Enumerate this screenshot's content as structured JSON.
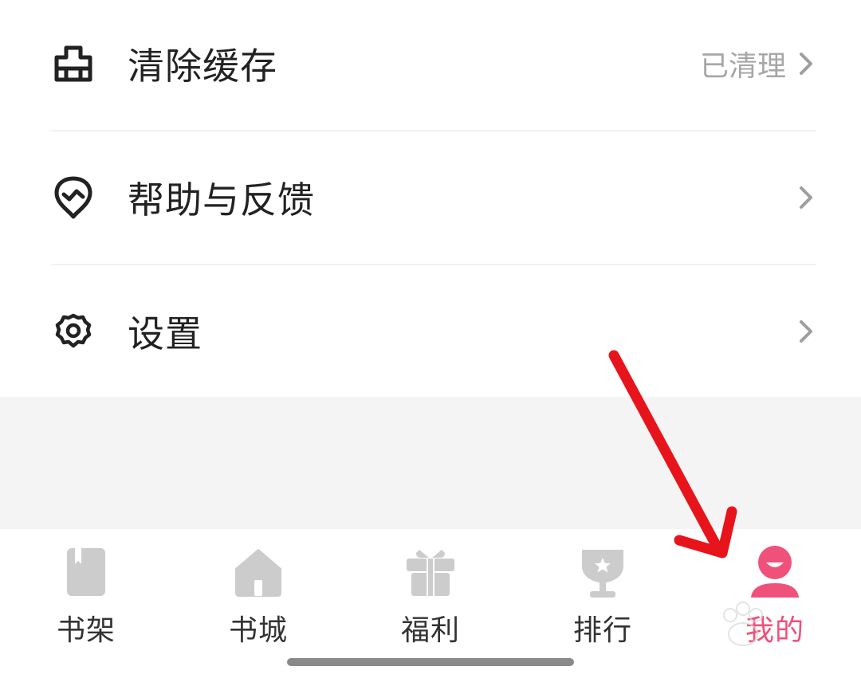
{
  "menu": {
    "items": [
      {
        "icon": "broom-icon",
        "label": "清除缓存",
        "value": "已清理"
      },
      {
        "icon": "feedback-heart-icon",
        "label": "帮助与反馈",
        "value": ""
      },
      {
        "icon": "gear-icon",
        "label": "设置",
        "value": ""
      }
    ]
  },
  "tabbar": {
    "tabs": [
      {
        "icon": "bookshelf-icon",
        "label": "书架"
      },
      {
        "icon": "home-icon",
        "label": "书城"
      },
      {
        "icon": "gift-icon",
        "label": "福利"
      },
      {
        "icon": "trophy-icon",
        "label": "排行"
      },
      {
        "icon": "user-icon",
        "label": "我的",
        "active": true
      }
    ]
  },
  "colors": {
    "accent": "#f0517a",
    "inactive_icon": "#cccccc",
    "arrow": "#e8141b"
  }
}
